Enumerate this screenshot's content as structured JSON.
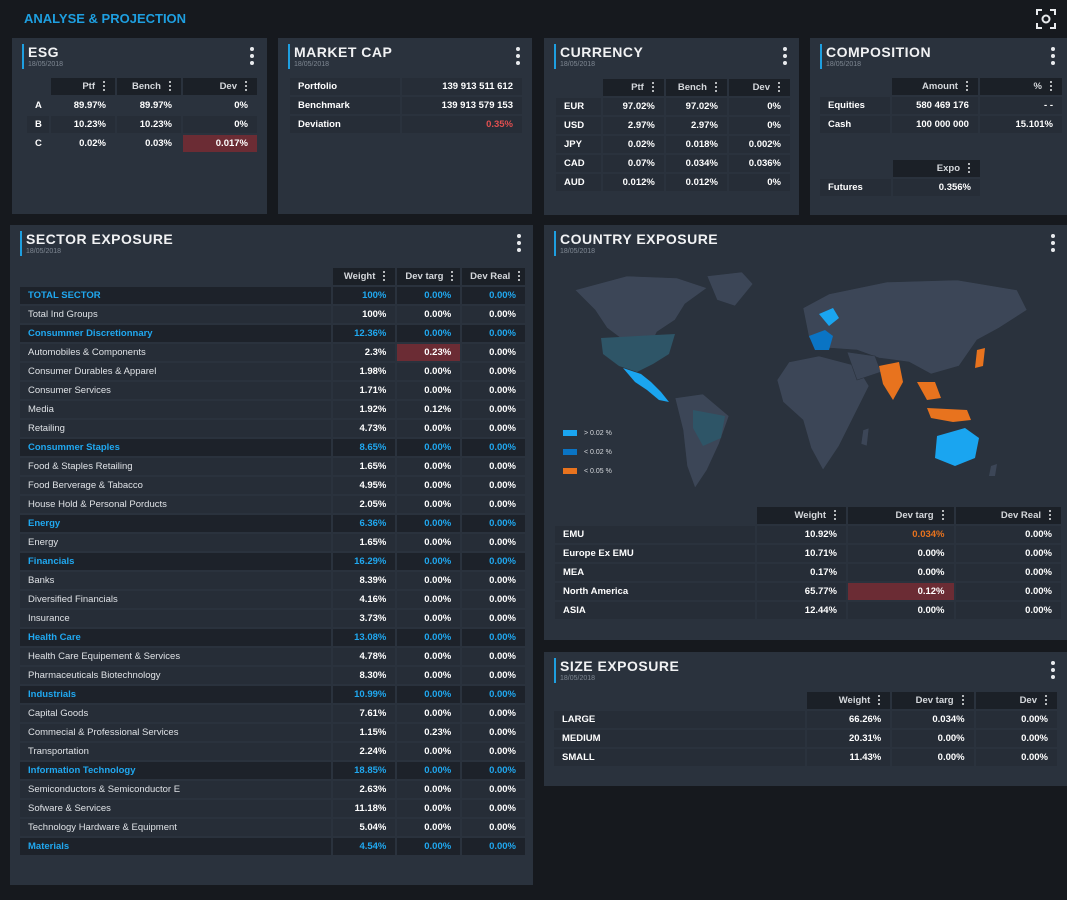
{
  "app": {
    "title": "ANALYSE & PROJECTION",
    "screenshot_icon": "screenshot-icon"
  },
  "colors": {
    "accent": "#1e9fe0",
    "group_text": "#20a8f0",
    "negative": "#e04f4f",
    "highlight_bg": "#6b2c34",
    "orange": "#e8731e",
    "map_light_blue": "#1aa5f0",
    "map_blue": "#0a74c4",
    "map_teal": "#2e5567",
    "map_base": "#3c4657"
  },
  "esg": {
    "title": "ESG",
    "date": "18/05/2018",
    "columns": [
      "Ptf",
      "Bench",
      "Dev"
    ],
    "rows": [
      {
        "label": "A",
        "ptf": "89.97%",
        "bench": "89.97%",
        "dev": "0%"
      },
      {
        "label": "B",
        "ptf": "10.23%",
        "bench": "10.23%",
        "dev": "0%"
      },
      {
        "label": "C",
        "ptf": "0.02%",
        "bench": "0.03%",
        "dev": "0.017%"
      }
    ]
  },
  "market_cap": {
    "title": "MARKET CAP",
    "date": "18/05/2018",
    "rows": [
      {
        "label": "Portfolio",
        "value": "139 913 511 612"
      },
      {
        "label": "Benchmark",
        "value": "139 913 579 153"
      },
      {
        "label": "Deviation",
        "value": "0.35%"
      }
    ]
  },
  "currency": {
    "title": "CURRENCY",
    "date": "18/05/2018",
    "columns": [
      "Ptf",
      "Bench",
      "Dev"
    ],
    "rows": [
      {
        "label": "EUR",
        "ptf": "97.02%",
        "bench": "97.02%",
        "dev": "0%"
      },
      {
        "label": "USD",
        "ptf": "2.97%",
        "bench": "2.97%",
        "dev": "0%"
      },
      {
        "label": "JPY",
        "ptf": "0.02%",
        "bench": "0.018%",
        "dev": "0.002%"
      },
      {
        "label": "CAD",
        "ptf": "0.07%",
        "bench": "0.034%",
        "dev": "0.036%"
      },
      {
        "label": "AUD",
        "ptf": "0.012%",
        "bench": "0.012%",
        "dev": "0%"
      }
    ]
  },
  "composition": {
    "title": "COMPOSITION",
    "date": "18/05/2018",
    "columns": [
      "Amount",
      "%"
    ],
    "rows": [
      {
        "label": "Equities",
        "amount": "580 469 176",
        "pct": "- -"
      },
      {
        "label": "Cash",
        "amount": "100 000 000",
        "pct": "15.101%"
      }
    ],
    "expo_header": "Expo",
    "futures": {
      "label": "Futures",
      "expo": "0.356%"
    }
  },
  "sector": {
    "title": "SECTOR EXPOSURE",
    "date": "18/05/2018",
    "columns": [
      "Weight",
      "Dev targ",
      "Dev Real"
    ],
    "rows": [
      {
        "label": "TOTAL SECTOR",
        "weight": "100%",
        "dev_targ": "0.00%",
        "dev_real": "0.00%",
        "kind": "group"
      },
      {
        "label": "Total Ind Groups",
        "weight": "100%",
        "dev_targ": "0.00%",
        "dev_real": "0.00%",
        "kind": "item"
      },
      {
        "label": "Consummer Discretionnary",
        "weight": "12.36%",
        "dev_targ": "0.00%",
        "dev_real": "0.00%",
        "kind": "group"
      },
      {
        "label": "Automobiles & Components",
        "weight": "2.3%",
        "dev_targ": "0.23%",
        "dev_real": "0.00%",
        "kind": "item",
        "highlight": true
      },
      {
        "label": "Consumer Durables & Apparel",
        "weight": "1.98%",
        "dev_targ": "0.00%",
        "dev_real": "0.00%",
        "kind": "item"
      },
      {
        "label": "Consumer Services",
        "weight": "1.71%",
        "dev_targ": "0.00%",
        "dev_real": "0.00%",
        "kind": "item"
      },
      {
        "label": "Media",
        "weight": "1.92%",
        "dev_targ": "0.12%",
        "dev_real": "0.00%",
        "kind": "item"
      },
      {
        "label": "Retailing",
        "weight": "4.73%",
        "dev_targ": "0.00%",
        "dev_real": "0.00%",
        "kind": "item"
      },
      {
        "label": "Consummer Staples",
        "weight": "8.65%",
        "dev_targ": "0.00%",
        "dev_real": "0.00%",
        "kind": "group"
      },
      {
        "label": "Food & Staples Retailing",
        "weight": "1.65%",
        "dev_targ": "0.00%",
        "dev_real": "0.00%",
        "kind": "item"
      },
      {
        "label": "Food Berverage & Tabacco",
        "weight": "4.95%",
        "dev_targ": "0.00%",
        "dev_real": "0.00%",
        "kind": "item"
      },
      {
        "label": "House Hold & Personal Porducts",
        "weight": "2.05%",
        "dev_targ": "0.00%",
        "dev_real": "0.00%",
        "kind": "item"
      },
      {
        "label": "Energy",
        "weight": "6.36%",
        "dev_targ": "0.00%",
        "dev_real": "0.00%",
        "kind": "group"
      },
      {
        "label": "Energy",
        "weight": "1.65%",
        "dev_targ": "0.00%",
        "dev_real": "0.00%",
        "kind": "item"
      },
      {
        "label": "Financials",
        "weight": "16.29%",
        "dev_targ": "0.00%",
        "dev_real": "0.00%",
        "kind": "group"
      },
      {
        "label": "Banks",
        "weight": "8.39%",
        "dev_targ": "0.00%",
        "dev_real": "0.00%",
        "kind": "item"
      },
      {
        "label": "Diversified Financials",
        "weight": "4.16%",
        "dev_targ": "0.00%",
        "dev_real": "0.00%",
        "kind": "item"
      },
      {
        "label": "Insurance",
        "weight": "3.73%",
        "dev_targ": "0.00%",
        "dev_real": "0.00%",
        "kind": "item"
      },
      {
        "label": "Health Care",
        "weight": "13.08%",
        "dev_targ": "0.00%",
        "dev_real": "0.00%",
        "kind": "group"
      },
      {
        "label": "Health Care Equipement & Services",
        "weight": "4.78%",
        "dev_targ": "0.00%",
        "dev_real": "0.00%",
        "kind": "item"
      },
      {
        "label": "Pharmaceuticals Biotechnology",
        "weight": "8.30%",
        "dev_targ": "0.00%",
        "dev_real": "0.00%",
        "kind": "item"
      },
      {
        "label": "Industrials",
        "weight": "10.99%",
        "dev_targ": "0.00%",
        "dev_real": "0.00%",
        "kind": "group"
      },
      {
        "label": "Capital Goods",
        "weight": "7.61%",
        "dev_targ": "0.00%",
        "dev_real": "0.00%",
        "kind": "item"
      },
      {
        "label": "Commecial & Professional Services",
        "weight": "1.15%",
        "dev_targ": "0.23%",
        "dev_real": "0.00%",
        "kind": "item"
      },
      {
        "label": "Transportation",
        "weight": "2.24%",
        "dev_targ": "0.00%",
        "dev_real": "0.00%",
        "kind": "item"
      },
      {
        "label": "Information Technology",
        "weight": "18.85%",
        "dev_targ": "0.00%",
        "dev_real": "0.00%",
        "kind": "group"
      },
      {
        "label": "Semiconductors & Semiconductor E",
        "weight": "2.63%",
        "dev_targ": "0.00%",
        "dev_real": "0.00%",
        "kind": "item"
      },
      {
        "label": "Sofware & Services",
        "weight": "11.18%",
        "dev_targ": "0.00%",
        "dev_real": "0.00%",
        "kind": "item"
      },
      {
        "label": "Technology Hardware & Equipment",
        "weight": "5.04%",
        "dev_targ": "0.00%",
        "dev_real": "0.00%",
        "kind": "item"
      },
      {
        "label": "Materials",
        "weight": "4.54%",
        "dev_targ": "0.00%",
        "dev_real": "0.00%",
        "kind": "group"
      }
    ]
  },
  "country": {
    "title": "COUNTRY EXPOSURE",
    "date": "18/05/2018",
    "legend": [
      {
        "label": "> 0.02 %",
        "color": "#1aa5f0"
      },
      {
        "label": "< 0.02 %",
        "color": "#0a74c4"
      },
      {
        "label": "< 0.05 %",
        "color": "#e8731e"
      }
    ],
    "columns": [
      "Weight",
      "Dev targ",
      "Dev Real"
    ],
    "rows": [
      {
        "label": "EMU",
        "weight": "10.92%",
        "dev_targ": "0.034%",
        "dev_real": "0.00%"
      },
      {
        "label": "Europe Ex EMU",
        "weight": "10.71%",
        "dev_targ": "0.00%",
        "dev_real": "0.00%"
      },
      {
        "label": "MEA",
        "weight": "0.17%",
        "dev_targ": "0.00%",
        "dev_real": "0.00%"
      },
      {
        "label": "North America",
        "weight": "65.77%",
        "dev_targ": "0.12%",
        "dev_real": "0.00%"
      },
      {
        "label": "ASIA",
        "weight": "12.44%",
        "dev_targ": "0.00%",
        "dev_real": "0.00%"
      }
    ]
  },
  "size": {
    "title": "SIZE EXPOSURE",
    "date": "18/05/2018",
    "columns": [
      "Weight",
      "Dev targ",
      "Dev"
    ],
    "rows": [
      {
        "label": "LARGE",
        "weight": "66.26%",
        "dev_targ": "0.034%",
        "dev": "0.00%"
      },
      {
        "label": "MEDIUM",
        "weight": "20.31%",
        "dev_targ": "0.00%",
        "dev": "0.00%"
      },
      {
        "label": "SMALL",
        "weight": "11.43%",
        "dev_targ": "0.00%",
        "dev": "0.00%"
      }
    ]
  }
}
